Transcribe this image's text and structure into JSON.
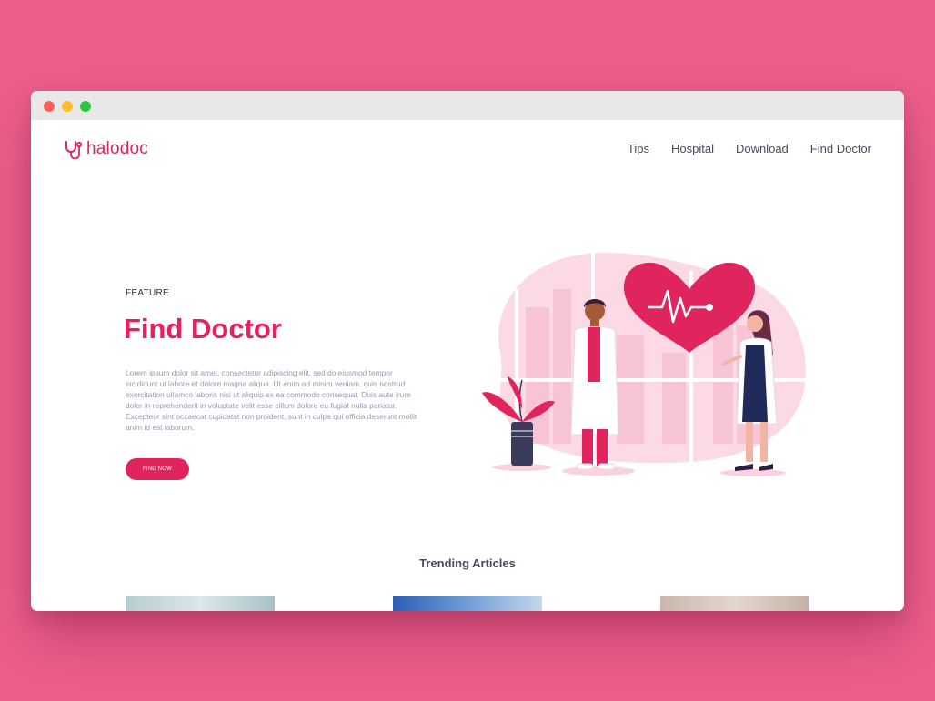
{
  "brand": {
    "name": "halodoc",
    "color": "#e0245e"
  },
  "nav": {
    "items": [
      "Tips",
      "Hospital",
      "Download",
      "Find Doctor"
    ]
  },
  "hero": {
    "label": "FEATURE",
    "title": "Find Doctor",
    "description": "Lorem ipsum dolor sit amet, consectetur adipiscing elit, sed do eiusmod tempor incididunt ut labore et dolore magna aliqua. Ut enim ad minim veniam, quis nostrud exercitation ullamco laboris nisi ut aliquip ex ea commodo consequat. Duis aute irure dolor in reprehenderit in voluptate velit esse cillum dolore eu fugiat nulla pariatur. Excepteur sint occaecat cupidatat non proident, sunt in culpa qui officia deserunt mollit anim id est laborum.",
    "cta_label": "FIND NOW"
  },
  "trending": {
    "title": "Trending Articles"
  },
  "colors": {
    "page_background": "#ec5f8b",
    "accent": "#e0245e",
    "text_dark": "#4a4a68",
    "text_muted": "#9a98ae"
  }
}
